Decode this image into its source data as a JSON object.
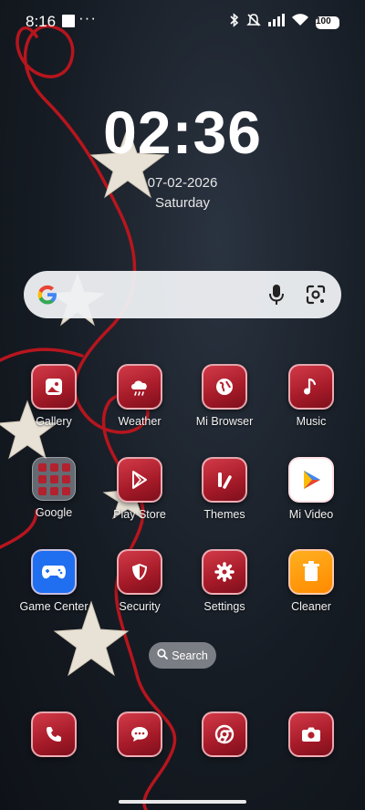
{
  "status_bar": {
    "time": "8:16",
    "dots": "···",
    "battery": "100",
    "icons": [
      "bluetooth-icon",
      "mute-icon",
      "signal-icon",
      "wifi-icon",
      "battery-icon"
    ]
  },
  "clock": {
    "time": "02:36",
    "date": "07-02-2026",
    "weekday": "Saturday"
  },
  "search_widget": {
    "icons": [
      "google-logo-icon",
      "microphone-icon",
      "lens-icon"
    ]
  },
  "apps": [
    {
      "label": "Gallery",
      "icon": "gallery-icon"
    },
    {
      "label": "Weather",
      "icon": "weather-icon"
    },
    {
      "label": "Mi Browser",
      "icon": "globe-icon"
    },
    {
      "label": "Music",
      "icon": "music-note-icon"
    },
    {
      "label": "Google",
      "icon": "folder-icon"
    },
    {
      "label": "Play Store",
      "icon": "play-store-icon"
    },
    {
      "label": "Themes",
      "icon": "themes-icon"
    },
    {
      "label": "Mi Video",
      "icon": "play-icon"
    },
    {
      "label": "Game Center",
      "icon": "gamepad-icon"
    },
    {
      "label": "Security",
      "icon": "shield-icon"
    },
    {
      "label": "Settings",
      "icon": "gear-icon"
    },
    {
      "label": "Cleaner",
      "icon": "trash-icon"
    }
  ],
  "search_pill": {
    "label": "Search"
  },
  "dock": [
    {
      "icon": "phone-icon"
    },
    {
      "icon": "messages-icon"
    },
    {
      "icon": "chrome-icon"
    },
    {
      "icon": "camera-icon"
    }
  ],
  "colors": {
    "icon_red": "#b3202e",
    "yarn_red": "#c0151e",
    "background": "#161c24"
  }
}
